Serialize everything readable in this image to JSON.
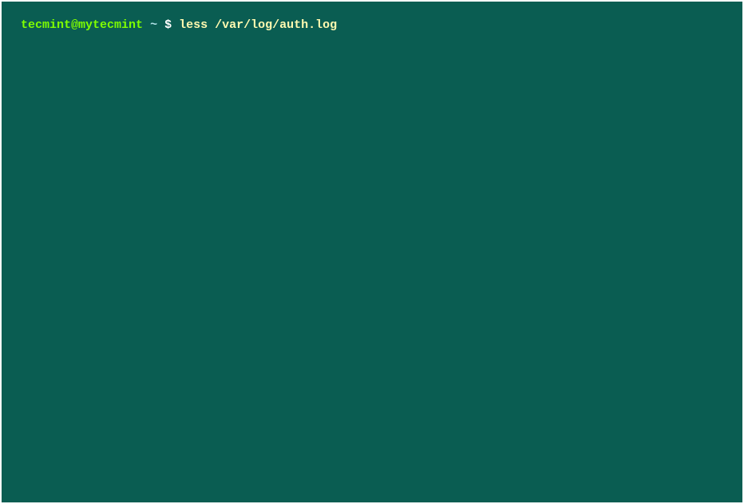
{
  "terminal": {
    "prompt": {
      "user_host": "tecmint@mytecmint",
      "cwd": "~",
      "symbol": "$"
    },
    "command": "less /var/log/auth.log"
  }
}
